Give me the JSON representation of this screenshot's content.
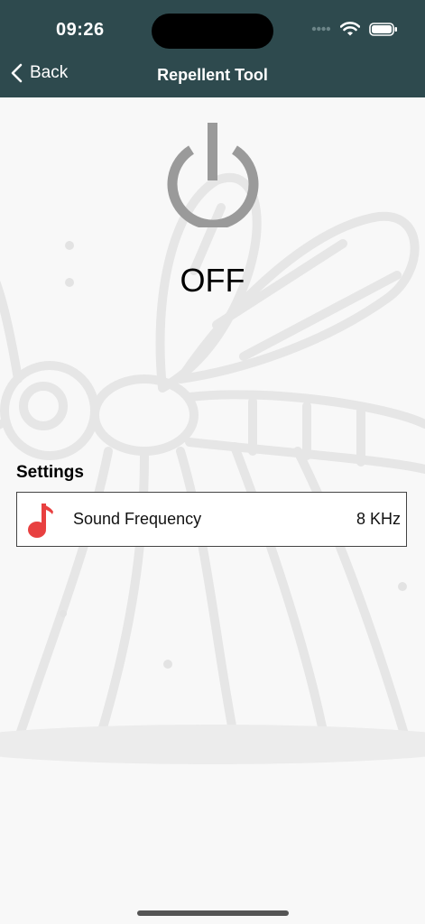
{
  "status_bar": {
    "time": "09:26"
  },
  "nav": {
    "back_label": "Back",
    "title": "Repellent Tool"
  },
  "power": {
    "state_label": "OFF"
  },
  "settings": {
    "title": "Settings",
    "items": [
      {
        "label": "Sound Frequency",
        "value": "8 KHz",
        "icon": "music-note-icon"
      }
    ]
  },
  "colors": {
    "header_bg": "#2e4a4e",
    "power_icon": "#9a9a9a",
    "music_icon": "#e84040"
  }
}
